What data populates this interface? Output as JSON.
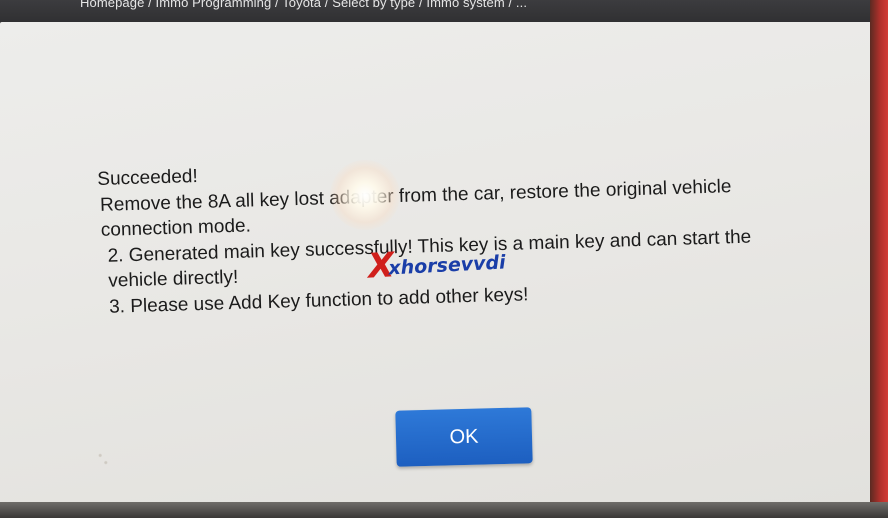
{
  "breadcrumb": {
    "text": "Homepage / Immo Programming / Toyota / Select by type / Immo system / ..."
  },
  "dialog": {
    "line1": "Succeeded!",
    "line2": "Remove the 8A all key lost adapter from the car, restore the original vehicle",
    "line3": "connection mode.",
    "line4": "2. Generated main key successfully! This key is a main key and can start the",
    "line5": "vehicle directly!",
    "line6": "3. Please use Add Key function to add other keys!",
    "ok_label": "OK"
  },
  "watermark": {
    "mark": "X",
    "text": "xhorsevvdi"
  },
  "colors": {
    "screen_bg": "#ebeae7",
    "button_blue": "#2169cc",
    "watermark_red": "#d0201c",
    "watermark_blue": "#1a3ea8"
  }
}
